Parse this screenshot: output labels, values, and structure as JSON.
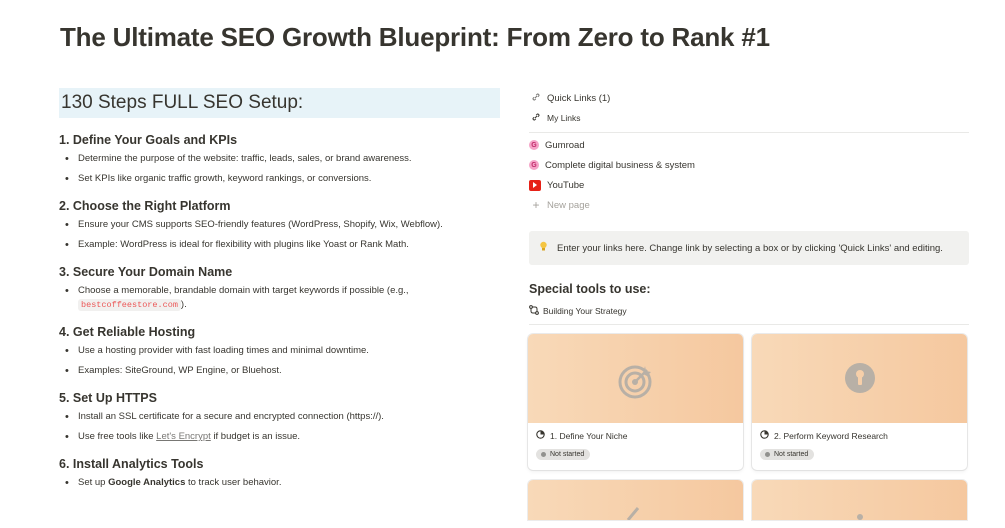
{
  "page_title": "The Ultimate SEO Growth Blueprint: From Zero to Rank #1",
  "left": {
    "heading": "130 Steps FULL SEO Setup:",
    "sections": [
      {
        "title": "1. Define Your Goals and KPIs",
        "b1": "Determine the purpose of the website: traffic, leads, sales, or brand awareness.",
        "b2": "Set KPIs like organic traffic growth, keyword rankings, or conversions."
      },
      {
        "title": "2. Choose the Right Platform",
        "b1": "Ensure your CMS supports SEO-friendly features (WordPress, Shopify, Wix, Webflow).",
        "b2": "Example: WordPress is ideal for flexibility with plugins like Yoast or Rank Math."
      },
      {
        "title": "3. Secure Your Domain Name",
        "b1": "Choose a memorable, brandable domain with target keywords if possible (e.g.,",
        "code": "bestcoffeestore.com",
        "b1_end": ")."
      },
      {
        "title": "4. Get Reliable Hosting",
        "b1": "Use a hosting provider with fast loading times and minimal downtime.",
        "b2": "Examples: SiteGround, WP Engine, or Bluehost."
      },
      {
        "title": "5. Set Up HTTPS",
        "b1": "Install an SSL certificate for a secure and encrypted connection (https://).",
        "b2_pre": "Use free tools like ",
        "b2_link": "Let's Encrypt",
        "b2_post": " if budget is an issue."
      },
      {
        "title": "6. Install Analytics Tools",
        "b1_pre": "Set up ",
        "b1_bold": "Google Analytics",
        "b1_post": " to track user behavior."
      }
    ]
  },
  "right": {
    "quick_links": "Quick Links (1)",
    "my_links": "My Links",
    "links": [
      "Gumroad",
      "Complete digital business & system",
      "YouTube"
    ],
    "new_page": "New page",
    "callout_icon": "lightbulb-icon",
    "callout_text": "Enter your links here. Change link by selecting a box or by clicking 'Quick Links' and editing.",
    "tools_title": "Special tools to use:",
    "tools_sub": "Building Your Strategy",
    "cards": [
      {
        "title": "1. Define Your Niche",
        "status": "Not started",
        "icon": "target-icon"
      },
      {
        "title": "2. Perform Keyword Research",
        "status": "Not started",
        "icon": "keyhole-icon"
      }
    ]
  },
  "colors": {
    "accent_bg": "#e7f3f8",
    "card_cover": "#f6cfa9",
    "code_red": "#eb5757"
  }
}
